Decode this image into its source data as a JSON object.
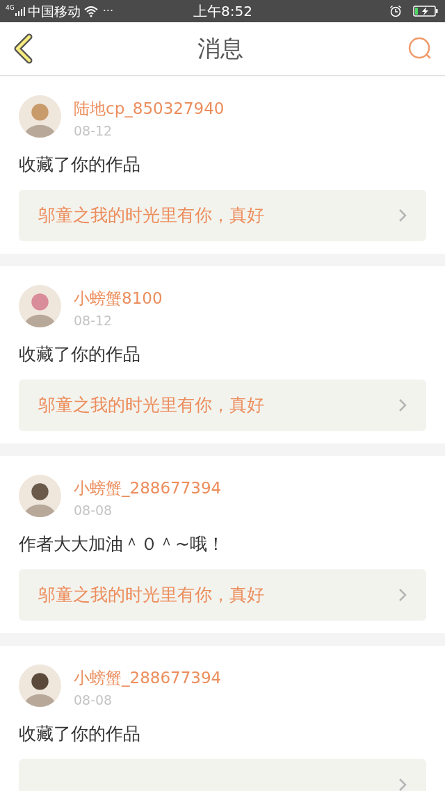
{
  "status_bar": {
    "network": "4G",
    "carrier": "中国移动",
    "more": "···",
    "time": "上午8:52"
  },
  "header": {
    "title": "消息"
  },
  "messages": [
    {
      "user": "陆地cp_850327940",
      "date": "08-12",
      "text": "收藏了你的作品",
      "work": "邬童之我的时光里有你，真好"
    },
    {
      "user": "小螃蟹8100",
      "date": "08-12",
      "text": "收藏了你的作品",
      "work": "邬童之我的时光里有你，真好"
    },
    {
      "user": "小螃蟹_288677394",
      "date": "08-08",
      "text": "作者大大加油＾０＾~哦！",
      "work": "邬童之我的时光里有你，真好"
    },
    {
      "user": "小螃蟹_288677394",
      "date": "08-08",
      "text": "收藏了你的作品"
    }
  ]
}
